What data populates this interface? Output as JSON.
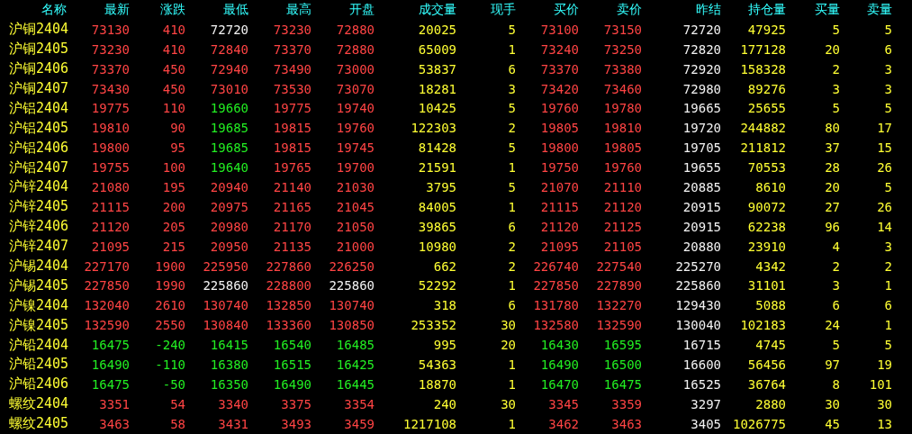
{
  "table": {
    "name_header": "名称",
    "columns": [
      {
        "label": "最新",
        "kind": "price"
      },
      {
        "label": "涨跌",
        "kind": "price"
      },
      {
        "label": "最低",
        "kind": "price"
      },
      {
        "label": "最高",
        "kind": "price"
      },
      {
        "label": "开盘",
        "kind": "price"
      },
      {
        "label": "成交量",
        "kind": "qty"
      },
      {
        "label": "现手",
        "kind": "qty"
      },
      {
        "label": "买价",
        "kind": "price"
      },
      {
        "label": "卖价",
        "kind": "price"
      },
      {
        "label": "昨结",
        "kind": "ref"
      },
      {
        "label": "持仓量",
        "kind": "qty"
      },
      {
        "label": "买量",
        "kind": "qty"
      },
      {
        "label": "卖量",
        "kind": "qty"
      }
    ],
    "rows": [
      {
        "name": "沪铜2404",
        "cells": [
          {
            "text": "73130",
            "color": "#ff4444"
          },
          {
            "text": "410",
            "color": "#ff4444"
          },
          {
            "text": "72720",
            "color": "#f2f2f2"
          },
          {
            "text": "73230",
            "color": "#ff4444"
          },
          {
            "text": "72880",
            "color": "#ff4444"
          },
          {
            "text": "20025"
          },
          {
            "text": "5"
          },
          {
            "text": "73100",
            "color": "#ff4444"
          },
          {
            "text": "73150",
            "color": "#ff4444"
          },
          {
            "text": "72720"
          },
          {
            "text": "47925"
          },
          {
            "text": "5"
          },
          {
            "text": "5"
          }
        ]
      },
      {
        "name": "沪铜2405",
        "cells": [
          {
            "text": "73230",
            "color": "#ff4444"
          },
          {
            "text": "410",
            "color": "#ff4444"
          },
          {
            "text": "72840",
            "color": "#ff4444"
          },
          {
            "text": "73370",
            "color": "#ff4444"
          },
          {
            "text": "72880",
            "color": "#ff4444"
          },
          {
            "text": "65009"
          },
          {
            "text": "1"
          },
          {
            "text": "73240",
            "color": "#ff4444"
          },
          {
            "text": "73250",
            "color": "#ff4444"
          },
          {
            "text": "72820"
          },
          {
            "text": "177128"
          },
          {
            "text": "20"
          },
          {
            "text": "6"
          }
        ]
      },
      {
        "name": "沪铜2406",
        "cells": [
          {
            "text": "73370",
            "color": "#ff4444"
          },
          {
            "text": "450",
            "color": "#ff4444"
          },
          {
            "text": "72940",
            "color": "#ff4444"
          },
          {
            "text": "73490",
            "color": "#ff4444"
          },
          {
            "text": "73000",
            "color": "#ff4444"
          },
          {
            "text": "53837"
          },
          {
            "text": "6"
          },
          {
            "text": "73370",
            "color": "#ff4444"
          },
          {
            "text": "73380",
            "color": "#ff4444"
          },
          {
            "text": "72920"
          },
          {
            "text": "158328"
          },
          {
            "text": "2"
          },
          {
            "text": "3"
          }
        ]
      },
      {
        "name": "沪铜2407",
        "cells": [
          {
            "text": "73430",
            "color": "#ff4444"
          },
          {
            "text": "450",
            "color": "#ff4444"
          },
          {
            "text": "73010",
            "color": "#ff4444"
          },
          {
            "text": "73530",
            "color": "#ff4444"
          },
          {
            "text": "73070",
            "color": "#ff4444"
          },
          {
            "text": "18281"
          },
          {
            "text": "3"
          },
          {
            "text": "73420",
            "color": "#ff4444"
          },
          {
            "text": "73460",
            "color": "#ff4444"
          },
          {
            "text": "72980"
          },
          {
            "text": "89276"
          },
          {
            "text": "3"
          },
          {
            "text": "3"
          }
        ]
      },
      {
        "name": "沪铝2404",
        "cells": [
          {
            "text": "19775",
            "color": "#ff4444"
          },
          {
            "text": "110",
            "color": "#ff4444"
          },
          {
            "text": "19660",
            "color": "#22ee22"
          },
          {
            "text": "19775",
            "color": "#ff4444"
          },
          {
            "text": "19740",
            "color": "#ff4444"
          },
          {
            "text": "10425"
          },
          {
            "text": "5"
          },
          {
            "text": "19760",
            "color": "#ff4444"
          },
          {
            "text": "19780",
            "color": "#ff4444"
          },
          {
            "text": "19665"
          },
          {
            "text": "25655"
          },
          {
            "text": "5"
          },
          {
            "text": "5"
          }
        ]
      },
      {
        "name": "沪铝2405",
        "cells": [
          {
            "text": "19810",
            "color": "#ff4444"
          },
          {
            "text": "90",
            "color": "#ff4444"
          },
          {
            "text": "19685",
            "color": "#22ee22"
          },
          {
            "text": "19815",
            "color": "#ff4444"
          },
          {
            "text": "19760",
            "color": "#ff4444"
          },
          {
            "text": "122303"
          },
          {
            "text": "2"
          },
          {
            "text": "19805",
            "color": "#ff4444"
          },
          {
            "text": "19810",
            "color": "#ff4444"
          },
          {
            "text": "19720"
          },
          {
            "text": "244882"
          },
          {
            "text": "80"
          },
          {
            "text": "17"
          }
        ]
      },
      {
        "name": "沪铝2406",
        "cells": [
          {
            "text": "19800",
            "color": "#ff4444"
          },
          {
            "text": "95",
            "color": "#ff4444"
          },
          {
            "text": "19685",
            "color": "#22ee22"
          },
          {
            "text": "19815",
            "color": "#ff4444"
          },
          {
            "text": "19745",
            "color": "#ff4444"
          },
          {
            "text": "81428"
          },
          {
            "text": "5"
          },
          {
            "text": "19800",
            "color": "#ff4444"
          },
          {
            "text": "19805",
            "color": "#ff4444"
          },
          {
            "text": "19705"
          },
          {
            "text": "211812"
          },
          {
            "text": "37"
          },
          {
            "text": "15"
          }
        ]
      },
      {
        "name": "沪铝2407",
        "cells": [
          {
            "text": "19755",
            "color": "#ff4444"
          },
          {
            "text": "100",
            "color": "#ff4444"
          },
          {
            "text": "19640",
            "color": "#22ee22"
          },
          {
            "text": "19765",
            "color": "#ff4444"
          },
          {
            "text": "19700",
            "color": "#ff4444"
          },
          {
            "text": "21591"
          },
          {
            "text": "1"
          },
          {
            "text": "19750",
            "color": "#ff4444"
          },
          {
            "text": "19760",
            "color": "#ff4444"
          },
          {
            "text": "19655"
          },
          {
            "text": "70553"
          },
          {
            "text": "28"
          },
          {
            "text": "26"
          }
        ]
      },
      {
        "name": "沪锌2404",
        "cells": [
          {
            "text": "21080",
            "color": "#ff4444"
          },
          {
            "text": "195",
            "color": "#ff4444"
          },
          {
            "text": "20940",
            "color": "#ff4444"
          },
          {
            "text": "21140",
            "color": "#ff4444"
          },
          {
            "text": "21030",
            "color": "#ff4444"
          },
          {
            "text": "3795"
          },
          {
            "text": "5"
          },
          {
            "text": "21070",
            "color": "#ff4444"
          },
          {
            "text": "21110",
            "color": "#ff4444"
          },
          {
            "text": "20885"
          },
          {
            "text": "8610"
          },
          {
            "text": "20"
          },
          {
            "text": "5"
          }
        ]
      },
      {
        "name": "沪锌2405",
        "cells": [
          {
            "text": "21115",
            "color": "#ff4444"
          },
          {
            "text": "200",
            "color": "#ff4444"
          },
          {
            "text": "20975",
            "color": "#ff4444"
          },
          {
            "text": "21165",
            "color": "#ff4444"
          },
          {
            "text": "21045",
            "color": "#ff4444"
          },
          {
            "text": "84005"
          },
          {
            "text": "1"
          },
          {
            "text": "21115",
            "color": "#ff4444"
          },
          {
            "text": "21120",
            "color": "#ff4444"
          },
          {
            "text": "20915"
          },
          {
            "text": "90072"
          },
          {
            "text": "27"
          },
          {
            "text": "26"
          }
        ]
      },
      {
        "name": "沪锌2406",
        "cells": [
          {
            "text": "21120",
            "color": "#ff4444"
          },
          {
            "text": "205",
            "color": "#ff4444"
          },
          {
            "text": "20980",
            "color": "#ff4444"
          },
          {
            "text": "21170",
            "color": "#ff4444"
          },
          {
            "text": "21050",
            "color": "#ff4444"
          },
          {
            "text": "39865"
          },
          {
            "text": "6"
          },
          {
            "text": "21120",
            "color": "#ff4444"
          },
          {
            "text": "21125",
            "color": "#ff4444"
          },
          {
            "text": "20915"
          },
          {
            "text": "62238"
          },
          {
            "text": "96"
          },
          {
            "text": "14"
          }
        ]
      },
      {
        "name": "沪锌2407",
        "cells": [
          {
            "text": "21095",
            "color": "#ff4444"
          },
          {
            "text": "215",
            "color": "#ff4444"
          },
          {
            "text": "20950",
            "color": "#ff4444"
          },
          {
            "text": "21135",
            "color": "#ff4444"
          },
          {
            "text": "21000",
            "color": "#ff4444"
          },
          {
            "text": "10980"
          },
          {
            "text": "2"
          },
          {
            "text": "21095",
            "color": "#ff4444"
          },
          {
            "text": "21105",
            "color": "#ff4444"
          },
          {
            "text": "20880"
          },
          {
            "text": "23910"
          },
          {
            "text": "4"
          },
          {
            "text": "3"
          }
        ]
      },
      {
        "name": "沪锡2404",
        "cells": [
          {
            "text": "227170",
            "color": "#ff4444"
          },
          {
            "text": "1900",
            "color": "#ff4444"
          },
          {
            "text": "225950",
            "color": "#ff4444"
          },
          {
            "text": "227860",
            "color": "#ff4444"
          },
          {
            "text": "226250",
            "color": "#ff4444"
          },
          {
            "text": "662"
          },
          {
            "text": "2"
          },
          {
            "text": "226740",
            "color": "#ff4444"
          },
          {
            "text": "227540",
            "color": "#ff4444"
          },
          {
            "text": "225270"
          },
          {
            "text": "4342"
          },
          {
            "text": "2"
          },
          {
            "text": "2"
          }
        ]
      },
      {
        "name": "沪锡2405",
        "cells": [
          {
            "text": "227850",
            "color": "#ff4444"
          },
          {
            "text": "1990",
            "color": "#ff4444"
          },
          {
            "text": "225860",
            "color": "#f2f2f2"
          },
          {
            "text": "228800",
            "color": "#ff4444"
          },
          {
            "text": "225860",
            "color": "#f2f2f2"
          },
          {
            "text": "52292"
          },
          {
            "text": "1"
          },
          {
            "text": "227850",
            "color": "#ff4444"
          },
          {
            "text": "227890",
            "color": "#ff4444"
          },
          {
            "text": "225860"
          },
          {
            "text": "31101"
          },
          {
            "text": "3"
          },
          {
            "text": "1"
          }
        ]
      },
      {
        "name": "沪镍2404",
        "cells": [
          {
            "text": "132040",
            "color": "#ff4444"
          },
          {
            "text": "2610",
            "color": "#ff4444"
          },
          {
            "text": "130740",
            "color": "#ff4444"
          },
          {
            "text": "132850",
            "color": "#ff4444"
          },
          {
            "text": "130740",
            "color": "#ff4444"
          },
          {
            "text": "318"
          },
          {
            "text": "6"
          },
          {
            "text": "131780",
            "color": "#ff4444"
          },
          {
            "text": "132270",
            "color": "#ff4444"
          },
          {
            "text": "129430"
          },
          {
            "text": "5088"
          },
          {
            "text": "6"
          },
          {
            "text": "6"
          }
        ]
      },
      {
        "name": "沪镍2405",
        "cells": [
          {
            "text": "132590",
            "color": "#ff4444"
          },
          {
            "text": "2550",
            "color": "#ff4444"
          },
          {
            "text": "130840",
            "color": "#ff4444"
          },
          {
            "text": "133360",
            "color": "#ff4444"
          },
          {
            "text": "130850",
            "color": "#ff4444"
          },
          {
            "text": "253352"
          },
          {
            "text": "30"
          },
          {
            "text": "132580",
            "color": "#ff4444"
          },
          {
            "text": "132590",
            "color": "#ff4444"
          },
          {
            "text": "130040"
          },
          {
            "text": "102183"
          },
          {
            "text": "24"
          },
          {
            "text": "1"
          }
        ]
      },
      {
        "name": "沪铅2404",
        "cells": [
          {
            "text": "16475",
            "color": "#22ee22"
          },
          {
            "text": "-240",
            "color": "#22ee22"
          },
          {
            "text": "16415",
            "color": "#22ee22"
          },
          {
            "text": "16540",
            "color": "#22ee22"
          },
          {
            "text": "16485",
            "color": "#22ee22"
          },
          {
            "text": "995"
          },
          {
            "text": "20"
          },
          {
            "text": "16430",
            "color": "#22ee22"
          },
          {
            "text": "16595",
            "color": "#22ee22"
          },
          {
            "text": "16715"
          },
          {
            "text": "4745"
          },
          {
            "text": "5"
          },
          {
            "text": "5"
          }
        ]
      },
      {
        "name": "沪铅2405",
        "cells": [
          {
            "text": "16490",
            "color": "#22ee22"
          },
          {
            "text": "-110",
            "color": "#22ee22"
          },
          {
            "text": "16380",
            "color": "#22ee22"
          },
          {
            "text": "16515",
            "color": "#22ee22"
          },
          {
            "text": "16425",
            "color": "#22ee22"
          },
          {
            "text": "54363"
          },
          {
            "text": "1"
          },
          {
            "text": "16490",
            "color": "#22ee22"
          },
          {
            "text": "16500",
            "color": "#22ee22"
          },
          {
            "text": "16600"
          },
          {
            "text": "56456"
          },
          {
            "text": "97"
          },
          {
            "text": "19"
          }
        ]
      },
      {
        "name": "沪铅2406",
        "cells": [
          {
            "text": "16475",
            "color": "#22ee22"
          },
          {
            "text": "-50",
            "color": "#22ee22"
          },
          {
            "text": "16350",
            "color": "#22ee22"
          },
          {
            "text": "16490",
            "color": "#22ee22"
          },
          {
            "text": "16445",
            "color": "#22ee22"
          },
          {
            "text": "18870"
          },
          {
            "text": "1"
          },
          {
            "text": "16470",
            "color": "#22ee22"
          },
          {
            "text": "16475",
            "color": "#22ee22"
          },
          {
            "text": "16525"
          },
          {
            "text": "36764"
          },
          {
            "text": "8"
          },
          {
            "text": "101"
          }
        ]
      },
      {
        "name": "螺纹2404",
        "cells": [
          {
            "text": "3351",
            "color": "#ff4444"
          },
          {
            "text": "54",
            "color": "#ff4444"
          },
          {
            "text": "3340",
            "color": "#ff4444"
          },
          {
            "text": "3375",
            "color": "#ff4444"
          },
          {
            "text": "3354",
            "color": "#ff4444"
          },
          {
            "text": "240"
          },
          {
            "text": "30"
          },
          {
            "text": "3345",
            "color": "#ff4444"
          },
          {
            "text": "3359",
            "color": "#ff4444"
          },
          {
            "text": "3297"
          },
          {
            "text": "2880"
          },
          {
            "text": "30"
          },
          {
            "text": "30"
          }
        ]
      },
      {
        "name": "螺纹2405",
        "cells": [
          {
            "text": "3463",
            "color": "#ff4444"
          },
          {
            "text": "58",
            "color": "#ff4444"
          },
          {
            "text": "3431",
            "color": "#ff4444"
          },
          {
            "text": "3493",
            "color": "#ff4444"
          },
          {
            "text": "3459",
            "color": "#ff4444"
          },
          {
            "text": "1217108"
          },
          {
            "text": "1"
          },
          {
            "text": "3462",
            "color": "#ff4444"
          },
          {
            "text": "3463",
            "color": "#ff4444"
          },
          {
            "text": "3405"
          },
          {
            "text": "1026775"
          },
          {
            "text": "45"
          },
          {
            "text": "13"
          }
        ]
      }
    ]
  }
}
